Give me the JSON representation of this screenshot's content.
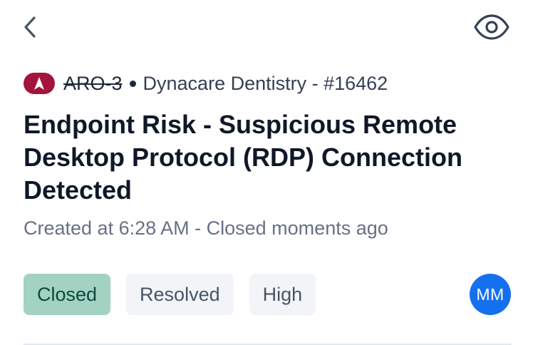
{
  "header": {
    "back_icon": "chevron-left-icon",
    "visibility_icon": "eye-icon"
  },
  "ticket": {
    "priority_icon": "priority-up-icon",
    "priority_color": "#a4133c",
    "ref_code": "ARO-3",
    "separator": "•",
    "org": "Dynacare Dentistry - #16462",
    "title": "Endpoint Risk - Suspicious Remote Desktop Protocol (RDP) Connection Detected",
    "created": "Created at 6:28 AM - Closed moments ago",
    "tags": {
      "status": "Closed",
      "resolution": "Resolved",
      "severity": "High"
    },
    "status_color": "#a3d2c2",
    "assignee_initials": "MM",
    "assignee_color": "#1570ef"
  }
}
